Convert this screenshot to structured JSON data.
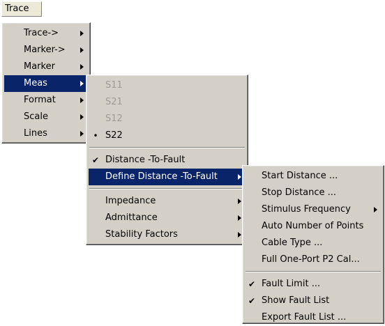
{
  "menubar": {
    "trace_label": "Trace"
  },
  "trace_menu": {
    "items": [
      {
        "label": "Trace->"
      },
      {
        "label": "Marker->"
      },
      {
        "label": "Marker"
      },
      {
        "label": "Meas"
      },
      {
        "label": "Format"
      },
      {
        "label": "Scale"
      },
      {
        "label": "Lines"
      }
    ]
  },
  "meas_menu": {
    "items": [
      {
        "label": "S11"
      },
      {
        "label": "S21"
      },
      {
        "label": "S12"
      },
      {
        "label": "S22",
        "mark": "•"
      },
      {
        "label": "Distance -To-Fault",
        "mark": "✔"
      },
      {
        "label": "Define Distance -To-Fault"
      },
      {
        "label": "Impedance"
      },
      {
        "label": "Admittance"
      },
      {
        "label": "Stability Factors"
      }
    ]
  },
  "dtf_menu": {
    "items": [
      {
        "label": "Start Distance ..."
      },
      {
        "label": "Stop Distance ..."
      },
      {
        "label": "Stimulus Frequency"
      },
      {
        "label": "Auto Number of Points"
      },
      {
        "label": "Cable Type ..."
      },
      {
        "label": "Full One-Port P2 Cal..."
      },
      {
        "label": "Fault Limit ...",
        "mark": "✔"
      },
      {
        "label": "Show Fault List",
        "mark": "✔"
      },
      {
        "label": "Export Fault List ..."
      }
    ]
  },
  "colors": {
    "menu_bg": "#d4d0c8",
    "highlight": "#0a246a",
    "disabled_text": "#9b9b9b"
  }
}
